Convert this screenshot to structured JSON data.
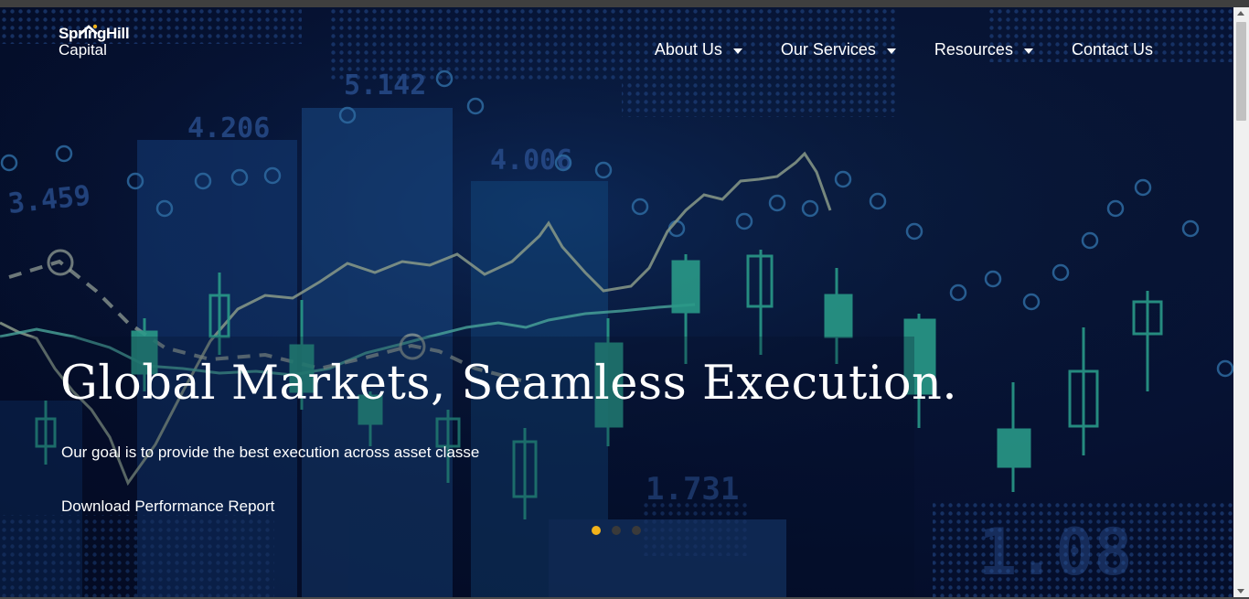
{
  "brand": {
    "name_line1": "SpringHill",
    "name_line2": "Capital",
    "accent": "#f2b21a"
  },
  "nav": {
    "items": [
      {
        "label": "About Us",
        "has_dropdown": true
      },
      {
        "label": "Our Services",
        "has_dropdown": true
      },
      {
        "label": "Resources",
        "has_dropdown": true
      },
      {
        "label": "Contact Us",
        "has_dropdown": false
      }
    ]
  },
  "hero": {
    "title": "Global Markets, Seamless Execution.",
    "subtitle": "Our goal is to provide the best execution across asset classe",
    "cta": "Download Performance Report",
    "slides": 3,
    "active_slide": 1,
    "background_numbers": [
      "5.142",
      "4.206",
      "4.006",
      "3.459",
      "1.731"
    ]
  },
  "colors": {
    "background": "#061233",
    "text": "#ffffff",
    "candle": "#2a9a88",
    "dot_inactive": "#3a3a3a"
  }
}
